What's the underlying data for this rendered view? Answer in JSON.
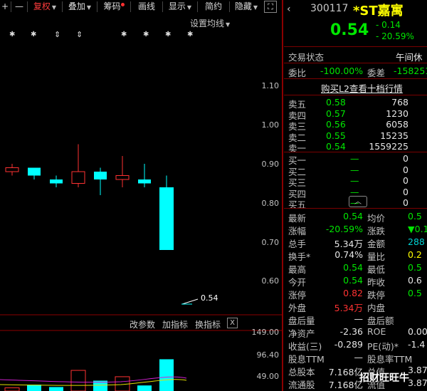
{
  "toolbar": {
    "plus": "+",
    "minus": "—",
    "fuquan": "复权",
    "diejia": "叠加",
    "chouma": "筹码",
    "huaxian": "画线",
    "xianshi": "显示",
    "jianyue": "简约",
    "yincang": "隐藏",
    "expand": "⛶"
  },
  "stock": {
    "code": "300117",
    "name": "*ST嘉寓",
    "price": "0.54",
    "change": "- 0.14",
    "change_pct": "- 20.59%"
  },
  "status": {
    "label": "交易状态",
    "value": "午间休"
  },
  "ratio": {
    "label1": "委比",
    "value1": "-100.00%",
    "label2": "委差",
    "value2": "-158251"
  },
  "l2_link": "购买L2查看十档行情",
  "sell": [
    {
      "label": "卖五",
      "price": "0.58",
      "vol": "768"
    },
    {
      "label": "卖四",
      "price": "0.57",
      "vol": "1230"
    },
    {
      "label": "卖三",
      "price": "0.56",
      "vol": "6058"
    },
    {
      "label": "卖二",
      "price": "0.55",
      "vol": "15235"
    },
    {
      "label": "卖一",
      "price": "0.54",
      "vol": "1559225"
    }
  ],
  "buy": [
    {
      "label": "买一",
      "price": "—",
      "vol": "0"
    },
    {
      "label": "买二",
      "price": "—",
      "vol": "0"
    },
    {
      "label": "买三",
      "price": "—",
      "vol": "0"
    },
    {
      "label": "买四",
      "price": "—",
      "vol": "0"
    },
    {
      "label": "买五",
      "price": "—",
      "vol": "0"
    }
  ],
  "collapse_icon": "︿",
  "stats": [
    {
      "l1": "最新",
      "v1": "0.54",
      "c1": "green",
      "l2": "均价",
      "v2": "0.5",
      "c2": "green"
    },
    {
      "l1": "涨幅",
      "v1": "-20.59%",
      "c1": "green",
      "l2": "涨跌",
      "v2": "▼0.1",
      "c2": "green"
    },
    {
      "l1": "总手",
      "v1": "5.34万",
      "c1": "white",
      "l2": "金额",
      "v2": "288",
      "c2": "cyan"
    },
    {
      "l1": "换手*",
      "v1": "0.74%",
      "c1": "white",
      "l2": "量比",
      "v2": "0.2",
      "c2": "yellow"
    },
    {
      "l1": "最高",
      "v1": "0.54",
      "c1": "green",
      "l2": "最低",
      "v2": "0.5",
      "c2": "green"
    },
    {
      "l1": "今开",
      "v1": "0.54",
      "c1": "green",
      "l2": "昨收",
      "v2": "0.6",
      "c2": "white"
    },
    {
      "l1": "涨停",
      "v1": "0.82",
      "c1": "red",
      "l2": "跌停",
      "v2": "0.5",
      "c2": "green"
    },
    {
      "l1": "外盘",
      "v1": "5.34万",
      "c1": "red",
      "l2": "内盘",
      "v2": "",
      "c2": "green"
    },
    {
      "l1": "盘后量",
      "v1": "—",
      "c1": "white",
      "l2": "盘后额",
      "v2": "",
      "c2": "white"
    },
    {
      "l1": "净资产",
      "v1": "-2.36",
      "c1": "white",
      "l2": "ROE",
      "v2": "0.00",
      "c2": "white"
    },
    {
      "l1": "收益(三)",
      "v1": "-0.289",
      "c1": "white",
      "l2": "PE(动)*",
      "v2": "-1.4",
      "c2": "white"
    },
    {
      "l1": "股息TTM",
      "v1": "—",
      "c1": "white",
      "l2": "股息率TTM",
      "v2": "",
      "c2": "white"
    },
    {
      "l1": "总股本",
      "v1": "7.168亿",
      "c1": "white",
      "l2": "总值",
      "v2": "3.871",
      "c2": "white"
    },
    {
      "l1": "流通股",
      "v1": "7.168亿",
      "c1": "white",
      "l2": "流值",
      "v2": "3.871",
      "c2": "white"
    }
  ],
  "chart": {
    "setting": "设置均线",
    "last_label": "0.54",
    "star": "✱",
    "arrow": "⇕"
  },
  "price_axis": [
    "1.10",
    "1.00",
    "0.90",
    "0.80",
    "0.70",
    "0.60"
  ],
  "chart_data": {
    "type": "candlestick",
    "ylim": [
      0.5,
      1.15
    ],
    "candles": [
      {
        "o": 0.88,
        "c": 0.89,
        "h": 0.9,
        "l": 0.87,
        "dir": "up"
      },
      {
        "o": 0.89,
        "c": 0.87,
        "h": 0.89,
        "l": 0.86,
        "dir": "down"
      },
      {
        "o": 0.86,
        "c": 0.85,
        "h": 0.87,
        "l": 0.84,
        "dir": "down"
      },
      {
        "o": 0.85,
        "c": 0.88,
        "h": 0.95,
        "l": 0.84,
        "dir": "up"
      },
      {
        "o": 0.88,
        "c": 0.86,
        "h": 0.89,
        "l": 0.82,
        "dir": "down"
      },
      {
        "o": 0.86,
        "c": 0.87,
        "h": 0.92,
        "l": 0.84,
        "dir": "up"
      },
      {
        "o": 0.86,
        "c": 0.85,
        "h": 0.9,
        "l": 0.84,
        "dir": "down"
      },
      {
        "o": 0.84,
        "c": 0.68,
        "h": 0.87,
        "l": 0.68,
        "dir": "down"
      },
      {
        "o": 0.54,
        "c": 0.54,
        "h": 0.54,
        "l": 0.54,
        "dir": "flat"
      }
    ],
    "volume_axis": [
      "149.00",
      "96.40",
      "49.00"
    ],
    "volume_ylim": [
      0,
      149
    ],
    "volumes": [
      {
        "v": 8,
        "dir": "up"
      },
      {
        "v": 16,
        "dir": "down"
      },
      {
        "v": 10,
        "dir": "down"
      },
      {
        "v": 52,
        "dir": "up"
      },
      {
        "v": 26,
        "dir": "down"
      },
      {
        "v": 36,
        "dir": "up"
      },
      {
        "v": 14,
        "dir": "down"
      },
      {
        "v": 80,
        "dir": "down"
      }
    ]
  },
  "indicator_bar": {
    "modify": "改参数",
    "add": "加指标",
    "switch": "换指标",
    "close": "X"
  },
  "watermark": "招财旺旺牛",
  "colors": {
    "up": "#ff3232",
    "down": "#00ffff",
    "panel_sep": "#8b0000"
  }
}
